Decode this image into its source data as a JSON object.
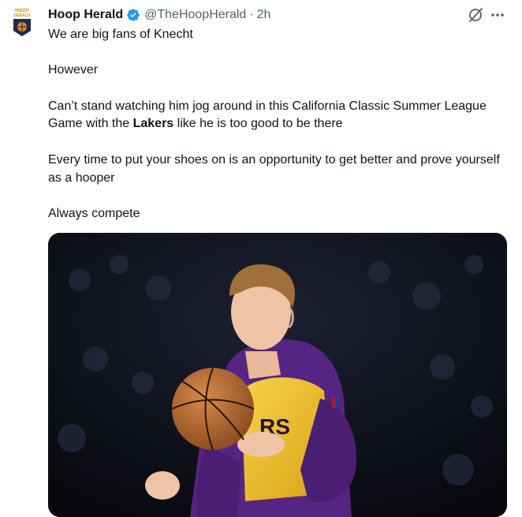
{
  "account": {
    "name": "Hoop Herald",
    "handle": "@TheHoopHerald",
    "separator": "·",
    "time": "2h",
    "avatar_lines": [
      "HOOP",
      "HERALD"
    ]
  },
  "tweet": {
    "line1": "We are big fans of Knecht",
    "line2": "However",
    "line3_pre": "Can’t stand watching him jog around in this California Classic Summer League Game with the ",
    "line3_bold": "Lakers",
    "line3_post": " like he is too good to be there",
    "line4": "Every time to put your shoes on is an opportunity to get better and prove yourself as a hooper",
    "line5": "Always compete"
  },
  "media": {
    "jersey_text": "RS"
  },
  "icons": {
    "verified": "verified-badge-icon",
    "grok": "grok-icon",
    "more": "more-icon"
  },
  "colors": {
    "verified_blue": "#1d9bf0",
    "purple": "#552583",
    "gold": "#f2c11f"
  }
}
